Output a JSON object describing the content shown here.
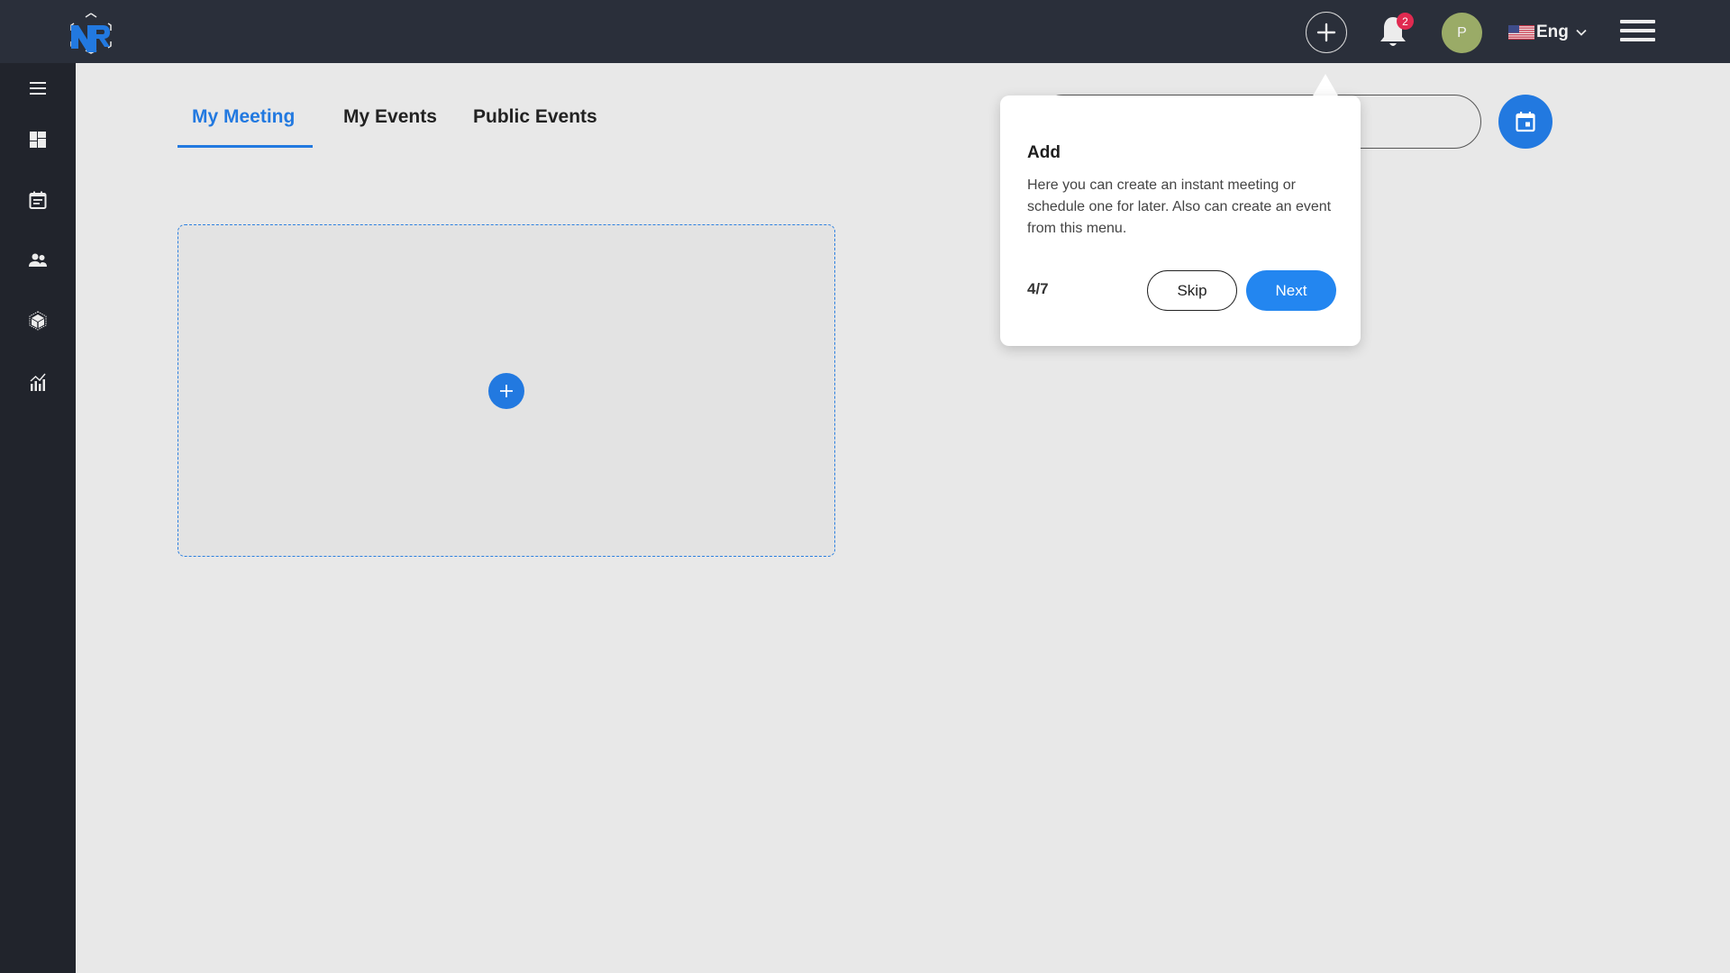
{
  "header": {
    "logo_alt": "NR",
    "add_button_label": "+",
    "notifications_count": "2",
    "avatar_initial": "P",
    "language": "Eng",
    "colors": {
      "background": "#2a2f3a",
      "badge": "#e02a50",
      "avatar": "#9aab67",
      "accent": "#2279e0"
    }
  },
  "sidebar": {
    "items": [
      {
        "icon": "menu-icon"
      },
      {
        "icon": "dashboard-icon"
      },
      {
        "icon": "calendar-note-icon"
      },
      {
        "icon": "people-icon"
      },
      {
        "icon": "cube-icon"
      },
      {
        "icon": "analytics-icon"
      }
    ]
  },
  "tabs": [
    {
      "label": "My Meeting",
      "active": true
    },
    {
      "label": "My Events",
      "active": false
    },
    {
      "label": "Public Events",
      "active": false
    }
  ],
  "search": {
    "value": "",
    "placeholder": ""
  },
  "card": {
    "add_label": "+"
  },
  "tour": {
    "title": "Add",
    "body": "Here you can create an instant meeting or schedule one for later. Also can create an event from this menu.",
    "step": "4/7",
    "skip_label": "Skip",
    "next_label": "Next"
  }
}
